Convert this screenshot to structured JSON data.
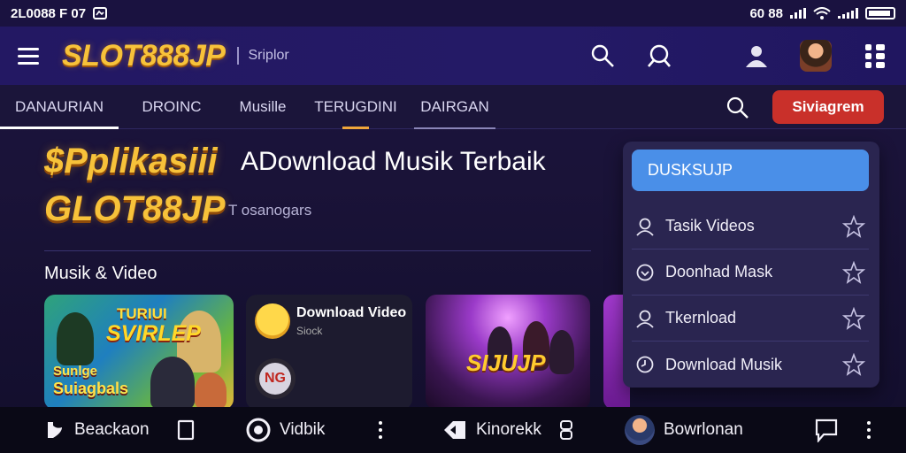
{
  "status": {
    "left_text": "2L0088 F 07",
    "right_text": "60 88"
  },
  "appbar": {
    "logo": "SLOT888JP",
    "subtitle": "Sriplor",
    "icons": [
      "menu-icon",
      "search-icon",
      "search-alt-icon",
      "user-icon",
      "avatar",
      "app-menu-icon"
    ]
  },
  "tabs": [
    {
      "label": "DANAURIAN",
      "active": true
    },
    {
      "label": "DROINC",
      "active": false
    },
    {
      "label": "Musille",
      "active": false
    },
    {
      "label": "TERUGDINI",
      "active": false
    },
    {
      "label": "DAIRGAN",
      "active": false
    }
  ],
  "nav": {
    "cta_label": "Siviagrem"
  },
  "hero": {
    "title": "$Pplikasiii",
    "subtitle": "ADownload Musik Terbaik",
    "brand": "GLOT88JP",
    "tag": "T osanogars"
  },
  "section": {
    "title": "Musik & Video"
  },
  "cards": {
    "card1": {
      "line1": "TURIUI",
      "line2": "SVIRLEP",
      "line3": "Sunlge",
      "line4": "Suiagbals"
    },
    "card2": {
      "title": "Download Video",
      "sub": "Siock",
      "badge": "NG"
    },
    "card3": {
      "text": "SIJUJP"
    }
  },
  "dropdown": {
    "search_value": "DUSKSUJP",
    "items": [
      {
        "label": "Tasik Videos",
        "icon": "user-icon"
      },
      {
        "label": "Doonhad Mask",
        "icon": "shield-icon"
      },
      {
        "label": "Tkernload",
        "icon": "user-icon"
      },
      {
        "label": "Download Musik",
        "icon": "clock-icon"
      }
    ]
  },
  "bottom": {
    "item1": "Beackaon",
    "item2": "Vidbik",
    "item3": "Kinorekk",
    "item4": "Bowrlonan"
  },
  "colors": {
    "accent_gold": "#f7c23a",
    "cta_red": "#c9302a",
    "dropdown_blue": "#4a8fe8",
    "bg_dark": "#1c1440"
  }
}
